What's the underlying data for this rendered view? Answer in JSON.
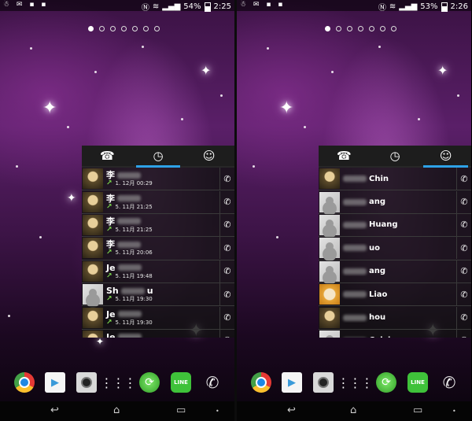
{
  "left": {
    "status": {
      "notif_icons": "☃ ✉ ▪ ▪",
      "battery": "54%",
      "time": "2:25"
    },
    "tabs": [
      {
        "icon": "phone-icon",
        "glyph": "☎"
      },
      {
        "icon": "clock-icon",
        "glyph": "◷"
      },
      {
        "icon": "person-icon",
        "glyph": "☺"
      }
    ],
    "active_tab": 1,
    "call_log": [
      {
        "name": "李",
        "date": "1. 12月 00:29",
        "avatar": "photo"
      },
      {
        "name": "李",
        "date": "5. 11月 21:25",
        "avatar": "photo"
      },
      {
        "name": "李",
        "date": "5. 11月 21:25",
        "avatar": "photo"
      },
      {
        "name": "李",
        "date": "5. 11月 20:06",
        "avatar": "photo"
      },
      {
        "name": "Je",
        "date": "5. 11月 19:48",
        "avatar": "photo"
      },
      {
        "name": "Sh",
        "suffix": "u",
        "date": "5. 11月 19:30",
        "avatar": "ph"
      },
      {
        "name": "Je",
        "date": "5. 11月 19:30",
        "avatar": "photo"
      },
      {
        "name": "Je",
        "date": "",
        "avatar": "photo"
      }
    ]
  },
  "right": {
    "status": {
      "notif_icons": "☃ ✉ ▪ ▪",
      "battery": "53%",
      "time": "2:26"
    },
    "active_tab": 2,
    "contacts": [
      {
        "name": "Chin",
        "avatar": "photo"
      },
      {
        "name": "ang",
        "avatar": "ph"
      },
      {
        "name": "Huang",
        "avatar": "ph"
      },
      {
        "name": "uo",
        "avatar": "ph"
      },
      {
        "name": "ang",
        "avatar": "ph"
      },
      {
        "name": "Liao",
        "avatar": "face"
      },
      {
        "name": "hou",
        "avatar": "photo"
      },
      {
        "name": "Calvin",
        "avatar": "ph"
      }
    ]
  },
  "dock": [
    {
      "name": "chrome-icon"
    },
    {
      "name": "play-store-icon"
    },
    {
      "name": "camera-icon"
    },
    {
      "name": "app-drawer-icon"
    },
    {
      "name": "sync-icon"
    },
    {
      "name": "line-app-icon",
      "label": "LINE"
    },
    {
      "name": "phone-app-icon"
    }
  ],
  "navbar": {
    "back": "↩",
    "home": "⌂",
    "recents": "▭",
    "dot": "•"
  },
  "colors": {
    "accent": "#2ea2e7",
    "arrow": "#7bd94c"
  }
}
